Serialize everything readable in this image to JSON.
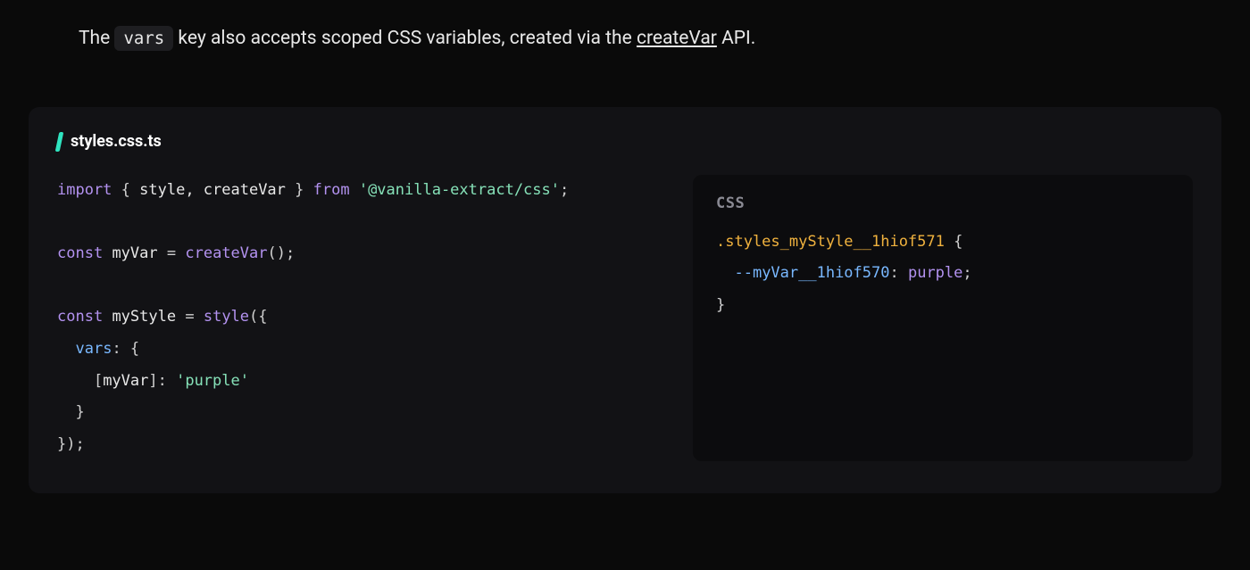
{
  "intro": {
    "before_code": "The ",
    "code": "vars",
    "after_code": " key also accepts scoped CSS variables, created via the ",
    "link_text": "createVar",
    "after_link": " API."
  },
  "file": {
    "name": "styles.css.ts"
  },
  "ts_code": {
    "l1": {
      "import": "import",
      "open": " { ",
      "names": "style, createVar",
      "close": " } ",
      "from": "from",
      "sp": " ",
      "pkg": "'@vanilla-extract/css'",
      "semi": ";"
    },
    "l3": {
      "const": "const",
      "sp1": " ",
      "name": "myVar",
      "sp2": " ",
      "eq": "=",
      "sp3": " ",
      "fn": "createVar",
      "call": "();"
    },
    "l5": {
      "const": "const",
      "sp1": " ",
      "name": "myStyle",
      "sp2": " ",
      "eq": "=",
      "sp3": " ",
      "fn": "style",
      "open": "({"
    },
    "l6": {
      "indent": "  ",
      "key": "vars",
      "colon": ": {"
    },
    "l7": {
      "indent": "    [",
      "var": "myVar",
      "mid": "]: ",
      "val": "'purple'"
    },
    "l8": {
      "text": "  }"
    },
    "l9": {
      "text": "});"
    }
  },
  "css_out": {
    "label": "CSS",
    "l1": {
      "selector": ".styles_myStyle__1hiof571",
      "open": " {"
    },
    "l2": {
      "indent": "  ",
      "prop": "--myVar__1hiof570",
      "colon": ": ",
      "val": "purple",
      "semi": ";"
    },
    "l3": {
      "text": "}"
    }
  }
}
